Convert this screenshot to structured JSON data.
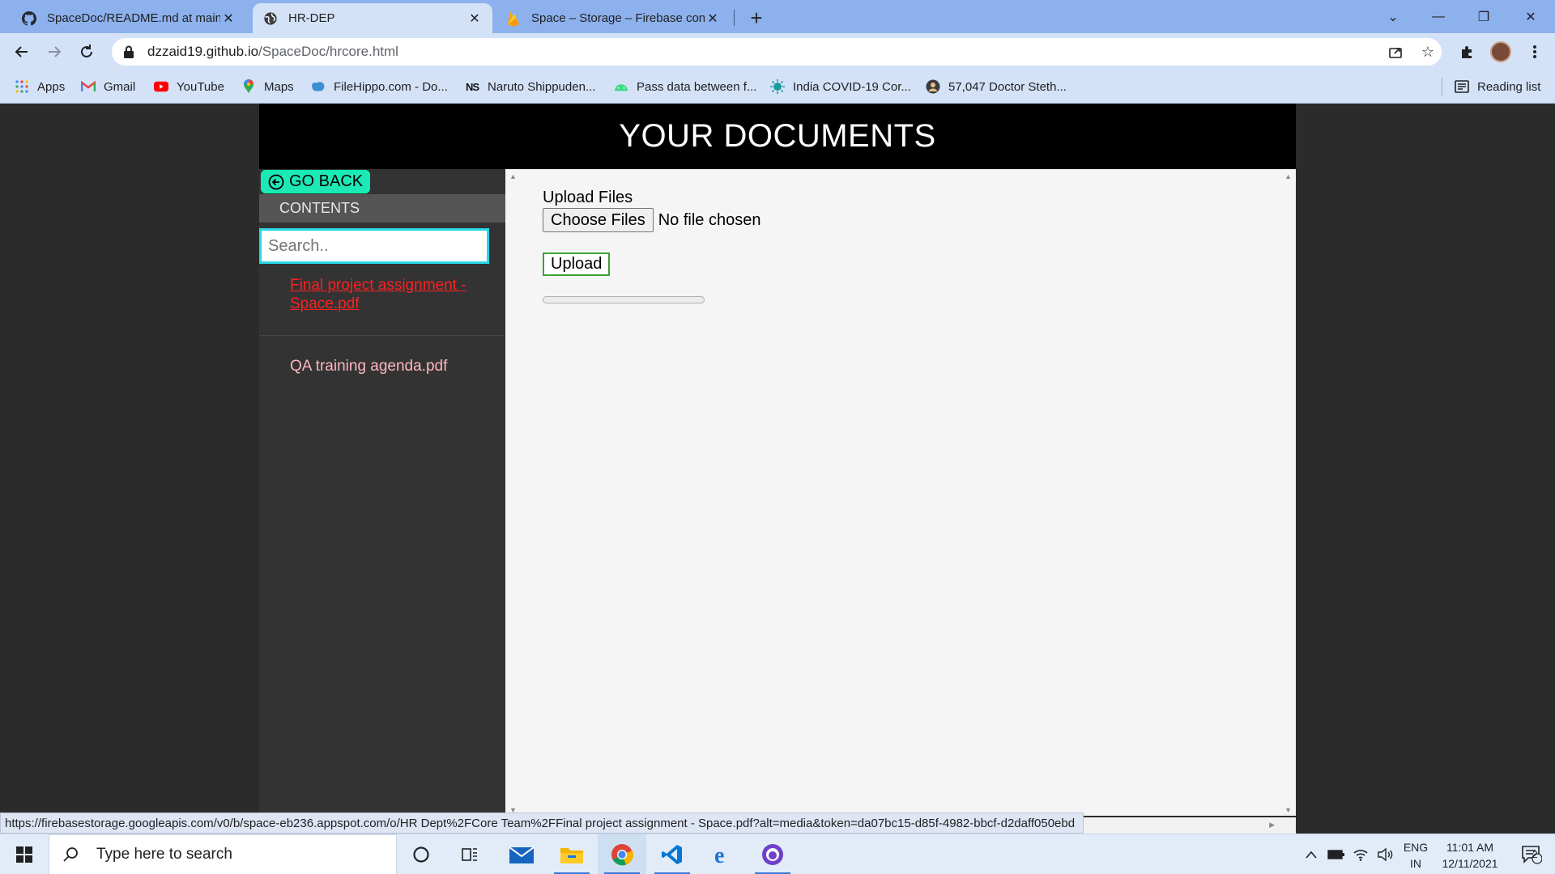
{
  "browser": {
    "tabs": [
      {
        "title": "SpaceDoc/README.md at main ·",
        "icon": "github-icon",
        "active": false
      },
      {
        "title": "HR-DEP",
        "icon": "globe-icon",
        "active": true
      },
      {
        "title": "Space – Storage – Firebase conso",
        "icon": "firebase-icon",
        "active": false
      }
    ],
    "address": {
      "host": "dzzaid19.github.io",
      "path": "/SpaceDoc/hrcore.html"
    },
    "bookmarks": [
      {
        "label": "Apps",
        "icon": "apps-grid-icon"
      },
      {
        "label": "Gmail",
        "icon": "gmail-icon"
      },
      {
        "label": "YouTube",
        "icon": "youtube-icon"
      },
      {
        "label": "Maps",
        "icon": "maps-pin-icon"
      },
      {
        "label": "FileHippo.com - Do...",
        "icon": "filehippo-icon"
      },
      {
        "label": "Naruto Shippuden...",
        "icon": "ns-icon"
      },
      {
        "label": "Pass data between f...",
        "icon": "android-icon"
      },
      {
        "label": "India COVID-19 Cor...",
        "icon": "covid-icon"
      },
      {
        "label": "57,047 Doctor Steth...",
        "icon": "doctor-icon"
      }
    ],
    "reading_list": "Reading list",
    "status_url": "https://firebasestorage.googleapis.com/v0/b/space-eb236.appspot.com/o/HR Dept%2FCore Team%2FFinal project assignment - Space.pdf?alt=media&token=da07bc15-d85f-4982-bbcf-d2daff050ebd"
  },
  "page": {
    "header": "YOUR DOCUMENTS",
    "go_back": "GO BACK",
    "contents": "CONTENTS",
    "search_placeholder": "Search..",
    "files": [
      {
        "name": "Final project assignment - Space.pdf"
      },
      {
        "name": "QA training agenda.pdf"
      }
    ],
    "upload_label": "Upload Files",
    "choose_files": "Choose Files",
    "no_file": "No file chosen",
    "upload_button": "Upload",
    "upload_progress": 0
  },
  "taskbar": {
    "search_placeholder": "Type here to search",
    "lang_top": "ENG",
    "lang_bottom": "IN",
    "time": "11:01 AM",
    "date": "12/11/2021",
    "notification_count": "2"
  },
  "colors": {
    "accent_teal": "#1de9b6",
    "search_border": "#28d7e7",
    "active_file": "#ff2020",
    "file_link": "#ffb6c1",
    "upload_border": "#3aa33a"
  }
}
